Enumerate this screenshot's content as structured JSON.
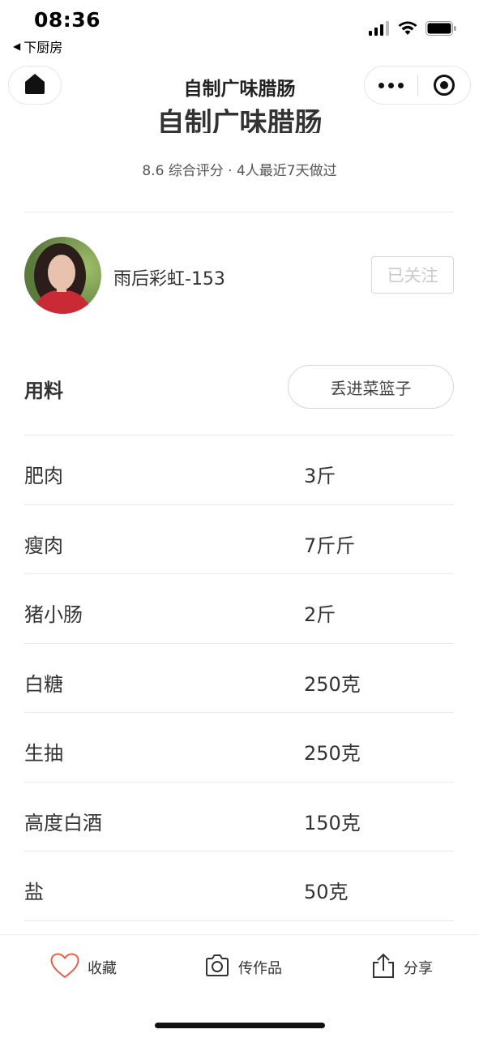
{
  "status_bar": {
    "time": "08:36",
    "back_app": "下厨房",
    "back_glyph": "◀"
  },
  "nav": {
    "title": "自制广味腊肠"
  },
  "recipe": {
    "title_cut": "自制广味腊肠",
    "rating_line": "8.6 综合评分 · 4人最近7天做过"
  },
  "author": {
    "name": "雨后彩虹-153",
    "follow_label": "已关注"
  },
  "ingredients": {
    "title": "用料",
    "basket_label": "丢进菜篮子",
    "items": [
      {
        "name": "肥肉",
        "amount": "3斤"
      },
      {
        "name": "瘦肉",
        "amount": "7斤斤"
      },
      {
        "name": "猪小肠",
        "amount": "2斤"
      },
      {
        "name": "白糖",
        "amount": "250克"
      },
      {
        "name": "生抽",
        "amount": "250克"
      },
      {
        "name": "高度白酒",
        "amount": "150克"
      },
      {
        "name": "盐",
        "amount": "50克"
      }
    ]
  },
  "bottom_bar": {
    "collect_label": "收藏",
    "upload_label": "传作品",
    "share_label": "分享"
  },
  "colors": {
    "heart_icon": "#e8604c",
    "follow_text": "#c9c9c9",
    "divider": "#ebebeb"
  },
  "icons": [
    "signal-icon",
    "wifi-icon",
    "battery-icon",
    "home-icon",
    "more-icon",
    "target-icon",
    "heart-icon",
    "camera-icon",
    "share-icon"
  ]
}
